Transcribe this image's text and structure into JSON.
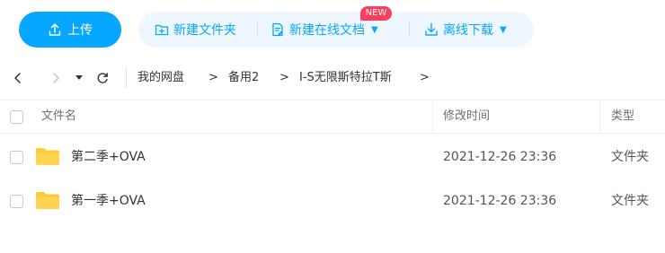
{
  "toolbar": {
    "upload_label": "上传",
    "new_folder_label": "新建文件夹",
    "new_online_doc_label": "新建在线文档",
    "new_badge": "NEW",
    "offline_download_label": "离线下载"
  },
  "breadcrumb": {
    "items": [
      "我的网盘",
      "备用2",
      "I-S无限斯特拉T斯"
    ],
    "separator": ">"
  },
  "table": {
    "headers": {
      "name": "文件名",
      "modified": "修改时间",
      "type": "类型"
    },
    "rows": [
      {
        "name": "第二季+OVA",
        "modified": "2021-12-26 23:36",
        "type": "文件夹"
      },
      {
        "name": "第一季+OVA",
        "modified": "2021-12-26 23:36",
        "type": "文件夹"
      }
    ]
  },
  "colors": {
    "accent": "#06a7ff",
    "pill_bg": "#eef7ff",
    "badge": "#ff3d5c",
    "folder": "#ffc93c"
  }
}
